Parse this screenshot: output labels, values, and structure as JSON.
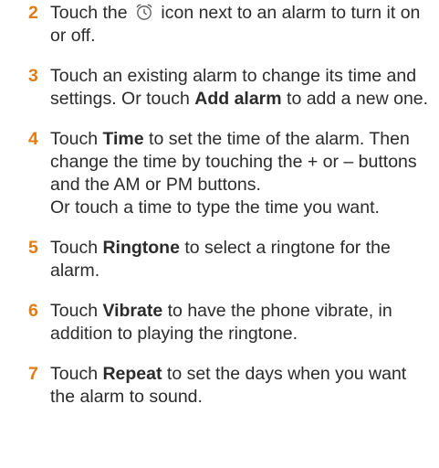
{
  "steps": [
    {
      "number": "2",
      "parts": [
        "Touch the ",
        " icon next to an alarm to turn it on or off."
      ],
      "icon": "alarm-clock-icon"
    },
    {
      "number": "3",
      "parts": [
        "Touch an existing alarm to change its time and settings. Or touch ",
        "Add alarm",
        " to add a new one."
      ]
    },
    {
      "number": "4",
      "parts": [
        "Touch ",
        "Time",
        " to set the time of the alarm. Then change the time by touching the + or – buttons and the AM or PM buttons.",
        "Or touch a time to type the time you want."
      ]
    },
    {
      "number": "5",
      "parts": [
        "Touch ",
        "Ringtone",
        " to select a ringtone for the alarm."
      ]
    },
    {
      "number": "6",
      "parts": [
        "Touch ",
        "Vibrate",
        " to have the phone vibrate, in addition to playing the ringtone."
      ]
    },
    {
      "number": "7",
      "parts": [
        "Touch ",
        "Repeat",
        " to set the days when you want the alarm to sound."
      ]
    }
  ],
  "colors": {
    "step_number": "#e07c13",
    "text": "#2b2b2b"
  }
}
